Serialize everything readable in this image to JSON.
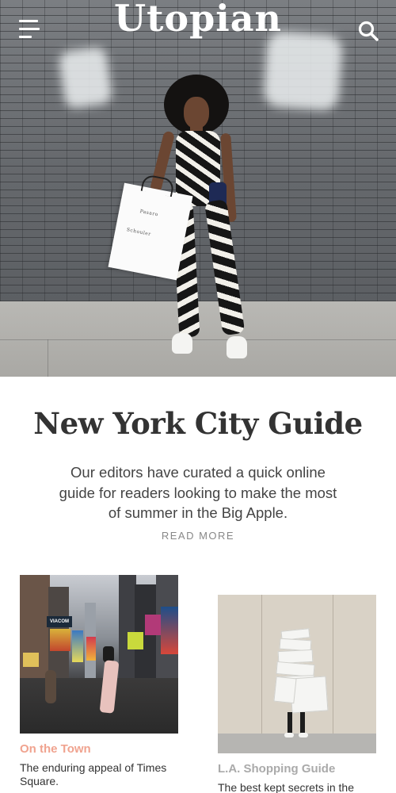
{
  "header": {
    "logo": "Utopian",
    "menu_icon": "hamburger-menu-icon",
    "search_icon": "search-icon"
  },
  "hero": {
    "bag_text_1": "Pasaro",
    "bag_text_2": "Schouler"
  },
  "feature": {
    "title": "New York City Guide",
    "description": "Our editors have curated a quick online guide for readers looking to make the most of summer in the Big Apple.",
    "read_more": "READ MORE"
  },
  "cards": [
    {
      "title": "On the Town",
      "description": "The enduring appeal of Times Square.",
      "title_color": "#f0a38f"
    },
    {
      "title": "L.A. Shopping Guide",
      "description": "The best kept secrets in the",
      "title_color": "#aaaaaa"
    }
  ],
  "times_square_signs": [
    "VIACOM"
  ]
}
